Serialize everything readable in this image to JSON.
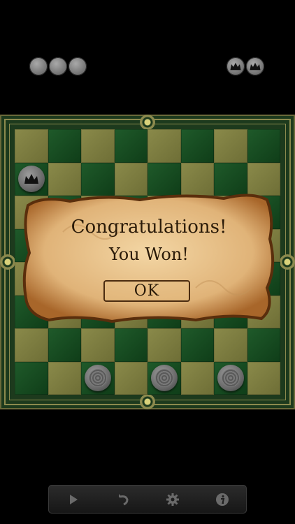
{
  "captured": {
    "left_men_count": 3,
    "right_kings_count": 2
  },
  "board": {
    "light_color": "#8a8a4a",
    "dark_color": "#1f5a2a",
    "pieces": [
      {
        "row": 1,
        "col": 0,
        "type": "king",
        "color": "gray"
      },
      {
        "row": 7,
        "col": 2,
        "type": "man",
        "color": "gray"
      },
      {
        "row": 7,
        "col": 4,
        "type": "man",
        "color": "gray"
      },
      {
        "row": 7,
        "col": 6,
        "type": "man",
        "color": "gray"
      }
    ]
  },
  "dialog": {
    "line1": "Congratulations!",
    "line2": "You Won!",
    "ok_label": "OK"
  },
  "toolbar": {
    "buttons": [
      {
        "name": "play",
        "icon": "play-icon"
      },
      {
        "name": "undo",
        "icon": "undo-icon"
      },
      {
        "name": "settings",
        "icon": "gear-icon"
      },
      {
        "name": "info",
        "icon": "info-icon"
      }
    ]
  }
}
